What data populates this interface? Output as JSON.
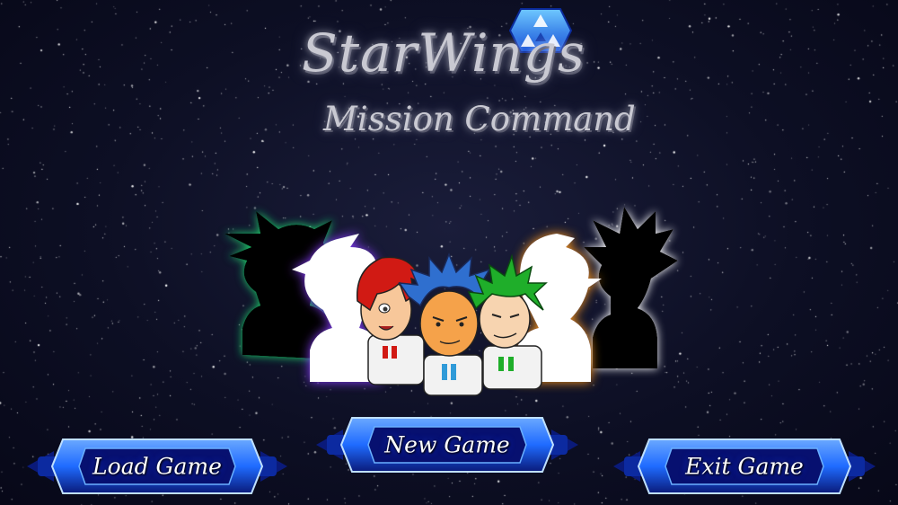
{
  "game": {
    "title": "StarWings",
    "subtitle": "Mission Command"
  },
  "menu": {
    "load_label": "Load Game",
    "new_label": "New Game",
    "exit_label": "Exit Game"
  },
  "colors": {
    "background": "#0d0f24",
    "title_text": "#c9c9d2",
    "button_blue": "#1f6bff",
    "button_dark": "#0a1a7a",
    "glow_green": "#1fd06a",
    "glow_purple": "#8a3cff",
    "glow_orange": "#ff9a1f",
    "hair_red": "#d11a14",
    "hair_blue": "#2f6fcf",
    "hair_green": "#1fae2a"
  },
  "characters": [
    {
      "name": "silhouette-green-glow",
      "icon": "character-silhouette-icon"
    },
    {
      "name": "silhouette-purple-glow",
      "icon": "character-silhouette-icon"
    },
    {
      "name": "red-haired-pilot",
      "icon": "character-portrait-icon"
    },
    {
      "name": "blue-haired-pilot",
      "icon": "character-portrait-icon"
    },
    {
      "name": "green-haired-pilot",
      "icon": "character-portrait-icon"
    },
    {
      "name": "silhouette-orange-glow",
      "icon": "character-silhouette-icon"
    },
    {
      "name": "silhouette-white-glow",
      "icon": "character-silhouette-icon"
    }
  ]
}
